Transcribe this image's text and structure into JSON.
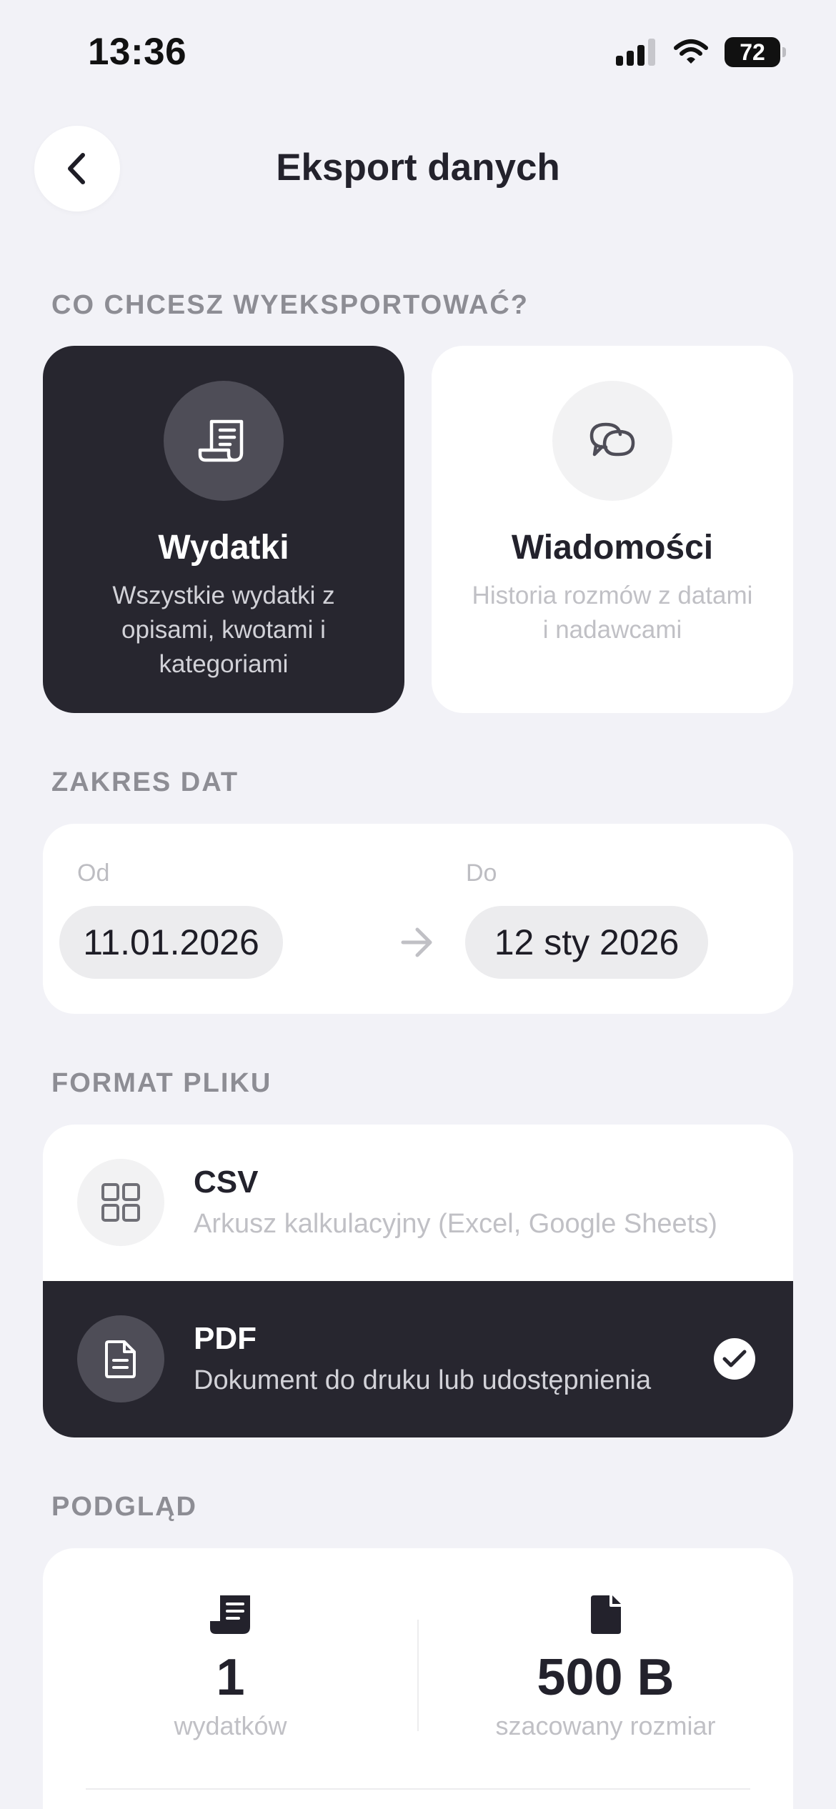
{
  "status_bar": {
    "time": "13:36",
    "battery": "72"
  },
  "header": {
    "title": "Eksport danych"
  },
  "sections": {
    "what": "CO CHCESZ WYEKSPORTOWAĆ?",
    "dates": "ZAKRES DAT",
    "format": "FORMAT PLIKU",
    "preview": "PODGLĄD"
  },
  "export_types": [
    {
      "title": "Wydatki",
      "description": "Wszystkie wydatki z opisami, kwotami i kategoriami",
      "icon": "receipt-icon",
      "selected": true
    },
    {
      "title": "Wiadomości",
      "description": "Historia rozmów z datami i nadawcami",
      "icon": "chat-bubbles-icon",
      "selected": false
    }
  ],
  "date_range": {
    "from_label": "Od",
    "from_value": "11.01.2026",
    "to_label": "Do",
    "to_value": "12 sty 2026"
  },
  "formats": [
    {
      "title": "CSV",
      "description": "Arkusz kalkulacyjny (Excel, Google Sheets)",
      "icon": "grid-icon",
      "selected": false
    },
    {
      "title": "PDF",
      "description": "Dokument do druku lub udostępnienia",
      "icon": "document-icon",
      "selected": true
    }
  ],
  "preview": {
    "count_value": "1",
    "count_label": "wydatków",
    "size_value": "500 B",
    "size_label": "szacowany rozmiar"
  },
  "colors": {
    "background": "#f2f2f7",
    "dark": "#27262f",
    "card": "#ffffff",
    "muted": "#8d8d94"
  }
}
